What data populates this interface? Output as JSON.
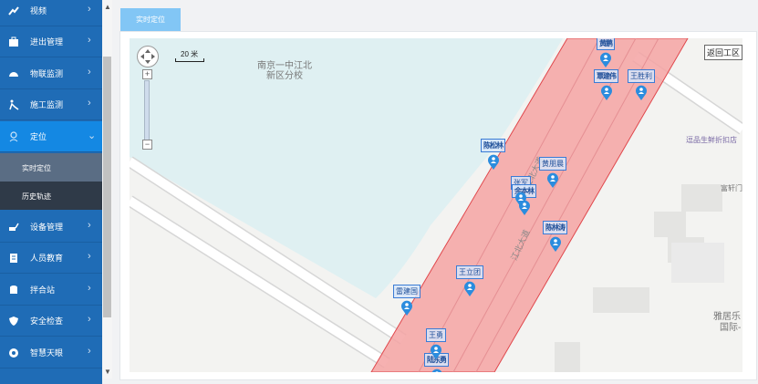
{
  "sidebar": {
    "items": [
      {
        "label": "视频",
        "icon": "video-icon"
      },
      {
        "label": "进出管理",
        "icon": "briefcase-icon"
      },
      {
        "label": "物联监测",
        "icon": "gauge-icon"
      },
      {
        "label": "施工监测",
        "icon": "worker-icon"
      },
      {
        "label": "定位",
        "icon": "location-icon",
        "expanded": true
      },
      {
        "label": "设备管理",
        "icon": "excavator-icon"
      },
      {
        "label": "人员教育",
        "icon": "book-icon"
      },
      {
        "label": "拌合站",
        "icon": "database-icon"
      },
      {
        "label": "安全检查",
        "icon": "shield-icon"
      },
      {
        "label": "智慧天眼",
        "icon": "eye-icon"
      }
    ],
    "subitems": [
      {
        "label": "实时定位",
        "selected": true
      },
      {
        "label": "历史轨迹",
        "selected": false
      }
    ]
  },
  "tab": {
    "label": "实时定位"
  },
  "map": {
    "scale_label": "20 米",
    "back_button": "返回工区",
    "pois": [
      {
        "text": "南京一中江北"
      },
      {
        "text": "新区分校"
      },
      {
        "text": "逗品生鲜折扣店"
      },
      {
        "text": "富轩门"
      },
      {
        "text": "雅居乐"
      },
      {
        "text": "国际-"
      }
    ],
    "road_labels": [
      "江北大道",
      "江北大道"
    ],
    "workers": [
      {
        "name": "黄鹏"
      },
      {
        "name": "覃建伟"
      },
      {
        "name": "王胜利"
      },
      {
        "name": "陈松林"
      },
      {
        "name": "黄朋晨"
      },
      {
        "name": "张军"
      },
      {
        "name": "余本林"
      },
      {
        "name": "陈林涛"
      },
      {
        "name": "王立团"
      },
      {
        "name": "雷建国"
      },
      {
        "name": "王勇"
      },
      {
        "name": "陆东勇"
      }
    ]
  },
  "colors": {
    "sidebar": "#1f6cb6",
    "active": "#1488e3",
    "zone": "#f4a3a3",
    "pin": "#2b8cde"
  }
}
